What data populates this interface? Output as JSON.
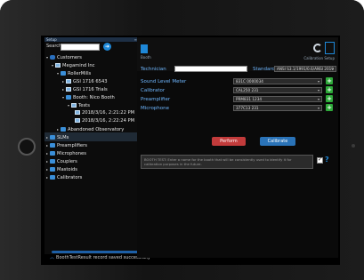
{
  "sidebar": {
    "header": "Setup",
    "search_label": "Search",
    "tree": [
      {
        "label": "Customers"
      },
      {
        "label": "Megamind Inc"
      },
      {
        "label": "RollerMills"
      },
      {
        "label": "GSI 1716 6543"
      },
      {
        "label": "GSI 1716 Trials"
      },
      {
        "label": "Booth: Nico Booth"
      },
      {
        "label": "Tests"
      },
      {
        "label": "2018/3/16, 2:21:22 PM"
      },
      {
        "label": "2018/3/16, 2:22:24 PM"
      },
      {
        "label": "Abandoned Observatory"
      },
      {
        "label": "SLMs"
      },
      {
        "label": "Preamplifiers"
      },
      {
        "label": "Microphones"
      },
      {
        "label": "Couplers"
      },
      {
        "label": "Mastoids"
      },
      {
        "label": "Calibrators"
      }
    ]
  },
  "status_text": "BoothTestResult record saved successfully",
  "topbar": {
    "booth_label": "Booth",
    "calibration_setup_label": "Calibration Setup"
  },
  "form": {
    "technician_label": "Technician",
    "standard_label": "Standard",
    "standard_value": "ANSI S3.1/1991/0.6/ANSI 2019",
    "rows": [
      {
        "label": "Sound Level Meter",
        "value": "831C 0000034"
      },
      {
        "label": "Calibrator",
        "value": "CAL250 231"
      },
      {
        "label": "Preamplifier",
        "value": "PRM831 1234"
      },
      {
        "label": "Microphone",
        "value": "377C13 231"
      }
    ]
  },
  "buttons": {
    "perform": "Perform",
    "calibrate": "Calibrate"
  },
  "note_text": "BOOTH TEST: Enter a name for the booth that will be consistently used to identify it for calibration purposes in the future.",
  "help_icon_text": "?"
}
